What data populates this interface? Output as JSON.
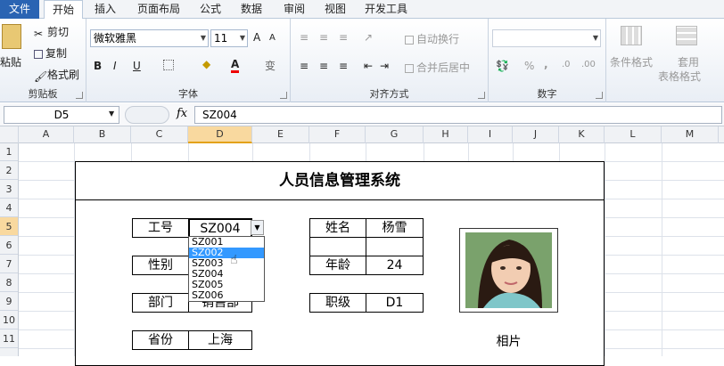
{
  "tabs": [
    "文件",
    "开始",
    "插入",
    "页面布局",
    "公式",
    "数据",
    "审阅",
    "视图",
    "开发工具"
  ],
  "clipboard": {
    "paste": "粘贴",
    "cut": "剪切",
    "copy": "复制",
    "painter": "格式刷",
    "label": "剪贴板"
  },
  "font": {
    "name": "微软雅黑",
    "size": "11",
    "bold": "B",
    "italic": "I",
    "underline": "U",
    "grow": "A",
    "shrink": "A",
    "wen": "变",
    "label": "字体"
  },
  "align": {
    "wrap": "自动换行",
    "merge": "合并后居中",
    "label": "对齐方式"
  },
  "number": {
    "percent": "%",
    "comma": ",",
    "label": "数字"
  },
  "styles": {
    "cond": "条件格式",
    "table1": "套用",
    "table2": "表格格式"
  },
  "formula": {
    "namebox": "D5",
    "fx": "fx",
    "content": "SZ004"
  },
  "columns": [
    "A",
    "B",
    "C",
    "D",
    "E",
    "F",
    "G",
    "H",
    "I",
    "J",
    "K",
    "L",
    "M"
  ],
  "rows": [
    "1",
    "2",
    "3",
    "4",
    "5",
    "6",
    "7",
    "8",
    "9",
    "10",
    "11"
  ],
  "form": {
    "title": "人员信息管理系统",
    "id_label": "工号",
    "id_value": "SZ004",
    "gender_label": "性别",
    "dept_label": "部门",
    "dept_value": "销售部",
    "province_label": "省份",
    "province_value": "上海",
    "name_label": "姓名",
    "name_value": "杨雪",
    "age_label": "年龄",
    "age_value": "24",
    "level_label": "职级",
    "level_value": "D1",
    "photo_caption": "相片"
  },
  "dropdown": {
    "options": [
      "SZ001",
      "SZ002",
      "SZ003",
      "SZ004",
      "SZ005",
      "SZ006"
    ],
    "highlighted": "SZ002"
  }
}
